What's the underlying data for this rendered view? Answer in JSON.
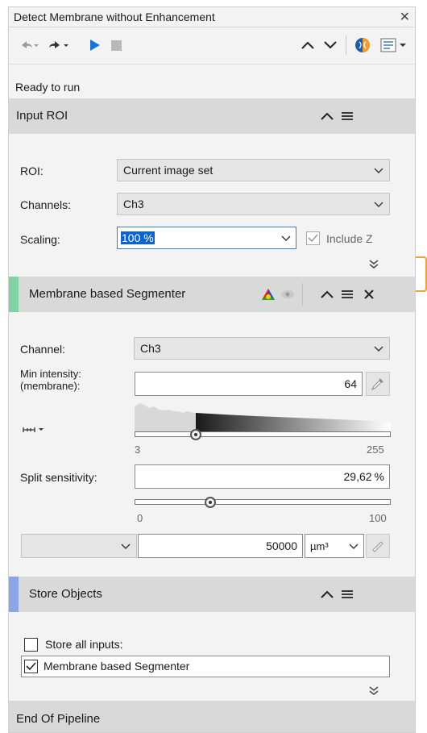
{
  "window": {
    "title": "Detect Membrane without Enhancement"
  },
  "status": {
    "text": "Ready to run"
  },
  "input_roi": {
    "title": "Input ROI",
    "roi_label": "ROI:",
    "roi_value": "Current image set",
    "channels_label": "Channels:",
    "channels_value": "Ch3",
    "scaling_label": "Scaling:",
    "scaling_value": "100 %",
    "include_z_label": "Include Z",
    "include_z_checked": true
  },
  "segmenter": {
    "title": "Membrane based Segmenter",
    "accent_color": "#7fd3a3",
    "channel_label": "Channel:",
    "channel_value": "Ch3",
    "min_intensity_label_line1": "Min intensity:",
    "min_intensity_label_line2": "(membrane):",
    "min_intensity_value": "64",
    "intensity_min_tick": "3",
    "intensity_max_tick": "255",
    "intensity_fraction": 0.24,
    "split_label": "Split sensitivity:",
    "split_value": "29,62",
    "split_unit": "%",
    "split_min_tick": "0",
    "split_max_tick": "100",
    "split_fraction": 0.2962,
    "size_value": "50000",
    "size_unit": "µm³"
  },
  "store": {
    "title": "Store Objects",
    "accent_color": "#8aa6e8",
    "store_all_label": "Store all inputs:",
    "store_all_checked": false,
    "item_label": "Membrane based Segmenter",
    "item_checked": true
  },
  "end": {
    "title": "End Of Pipeline"
  },
  "colors": {
    "play": "#1a73d9",
    "orange": "#e8a33b"
  },
  "icons": [
    "undo-icon",
    "redo-icon",
    "play-icon",
    "stop-icon",
    "chevron-up-icon",
    "chevron-down-icon",
    "brain-icon",
    "options-icon",
    "menu-icon",
    "close-icon",
    "color-wheel-icon",
    "eye-icon",
    "eyedropper-icon",
    "ruler-icon",
    "double-chevron-down-icon"
  ]
}
